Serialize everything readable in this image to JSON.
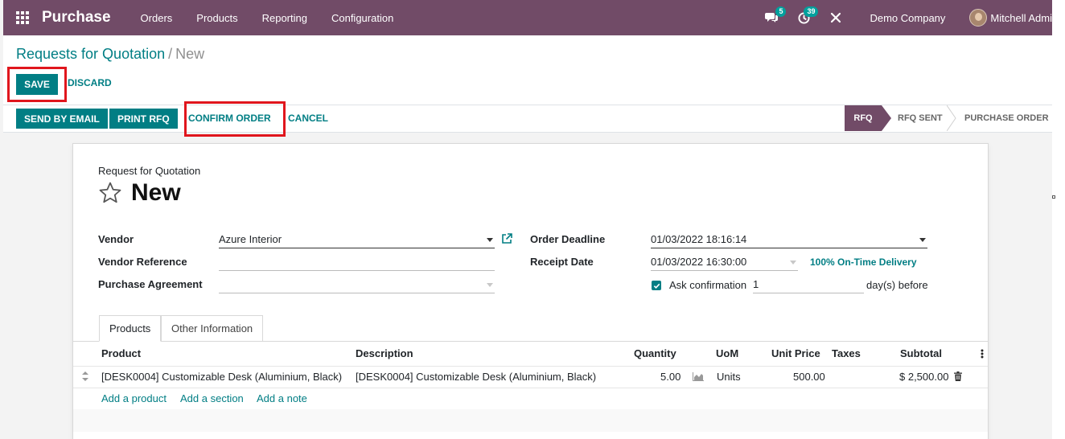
{
  "navbar": {
    "app_title": "Purchase",
    "menus": [
      "Orders",
      "Products",
      "Reporting",
      "Configuration"
    ],
    "chat_count": "5",
    "activity_count": "39",
    "company": "Demo Company",
    "user": "Mitchell Admi"
  },
  "breadcrumb": {
    "parent": "Requests for Quotation",
    "separator": "/",
    "current": "New"
  },
  "actions": {
    "save": "SAVE",
    "discard": "DISCARD"
  },
  "statusbar": {
    "send_email": "SEND BY EMAIL",
    "print_rfq": "PRINT RFQ",
    "confirm_order": "CONFIRM ORDER",
    "cancel": "CANCEL",
    "stages": [
      "RFQ",
      "RFQ SENT",
      "PURCHASE ORDER"
    ],
    "active_stage": "RFQ"
  },
  "form": {
    "doc_type": "Request for Quotation",
    "name": "New",
    "vendor_label": "Vendor",
    "vendor_value": "Azure Interior",
    "vendor_ref_label": "Vendor Reference",
    "vendor_ref_value": "",
    "agreement_label": "Purchase Agreement",
    "agreement_value": "",
    "deadline_label": "Order Deadline",
    "deadline_value": "01/03/2022 18:16:14",
    "receipt_label": "Receipt Date",
    "receipt_value": "01/03/2022 16:30:00",
    "on_time": "100% On-Time Delivery",
    "ask_confirmation_label": "Ask confirmation",
    "ask_confirmation_checked": true,
    "ask_days": "1",
    "days_before": "day(s) before"
  },
  "tabs": [
    "Products",
    "Other Information"
  ],
  "table": {
    "headers": [
      "Product",
      "Description",
      "Quantity",
      "UoM",
      "Unit Price",
      "Taxes",
      "Subtotal"
    ],
    "rows": [
      {
        "product": "[DESK0004] Customizable Desk (Aluminium, Black)",
        "description": "[DESK0004] Customizable Desk (Aluminium, Black)",
        "quantity": "5.00",
        "uom": "Units",
        "unit_price": "500.00",
        "taxes": "",
        "subtotal": "$ 2,500.00"
      }
    ],
    "add_product": "Add a product",
    "add_section": "Add a section",
    "add_note": "Add a note"
  },
  "colors": {
    "brand": "#714b67",
    "accent": "#017e84",
    "highlight": "#e0161d"
  }
}
